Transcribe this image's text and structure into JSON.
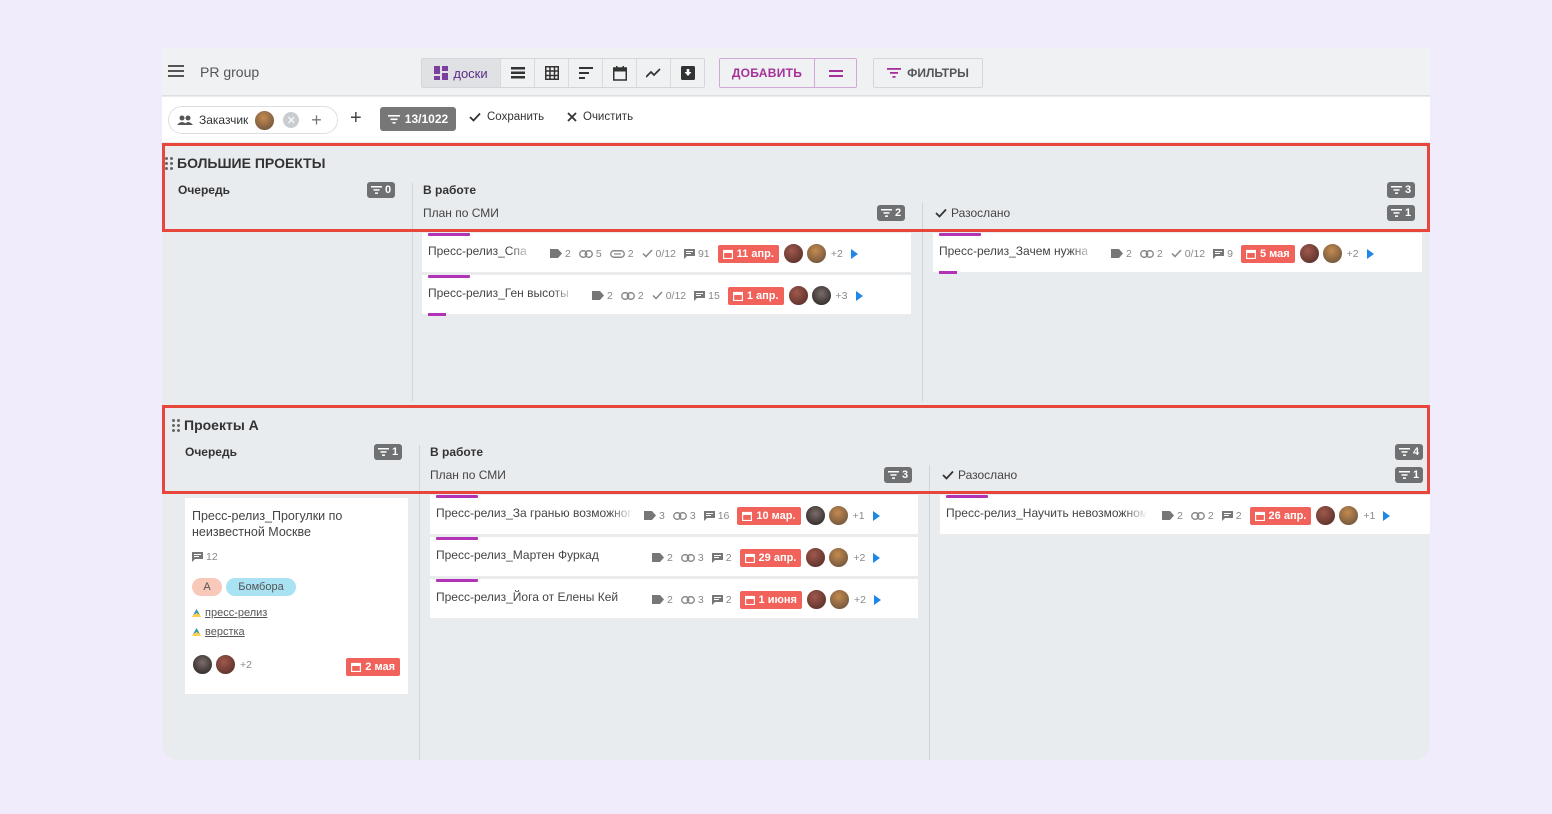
{
  "app": {
    "title": "PR group"
  },
  "toolbar": {
    "views": [
      {
        "label": "доски",
        "icon": "board-icon"
      },
      {
        "icon": "list-icon"
      },
      {
        "icon": "table-icon"
      },
      {
        "icon": "gantt-icon"
      },
      {
        "icon": "calendar-icon"
      },
      {
        "icon": "chart-icon"
      },
      {
        "icon": "archive-icon"
      }
    ],
    "add_label": "ДОБАВИТЬ",
    "filters_label": "ФИЛЬТРЫ"
  },
  "filterbar": {
    "chip_label": "Заказчик",
    "count": "13/1022",
    "save_label": "Сохранить",
    "clear_label": "Очистить"
  },
  "lanes": [
    {
      "title": "БОЛЬШИЕ ПРОЕКТЫ",
      "queue": {
        "label": "Очередь",
        "count": "0"
      },
      "in_work": {
        "label": "В работе",
        "count": "3"
      },
      "plan": {
        "label": "План по СМИ",
        "count": "2"
      },
      "sent": {
        "label": "Разослано",
        "count": "1"
      },
      "plan_cards": [
        {
          "title": "Пресс-релиз_Спа",
          "tags": "2",
          "links": "5",
          "files": "2",
          "checks": "0/12",
          "comments": "91",
          "date": "11 апр.",
          "more": "+2"
        },
        {
          "title": "Пресс-релиз_Ген высоты",
          "tags": "2",
          "links": "2",
          "checks": "0/12",
          "comments": "15",
          "date": "1 апр.",
          "more": "+3"
        }
      ],
      "sent_cards": [
        {
          "title": "Пресс-релиз_Зачем нужна",
          "tags": "2",
          "links": "2",
          "checks": "0/12",
          "comments": "9",
          "date": "5 мая",
          "more": "+2"
        }
      ]
    },
    {
      "title": "Проекты А",
      "queue": {
        "label": "Очередь",
        "count": "1"
      },
      "in_work": {
        "label": "В работе",
        "count": "4"
      },
      "plan": {
        "label": "План по СМИ",
        "count": "3"
      },
      "sent": {
        "label": "Разослано",
        "count": "1"
      },
      "queue_card": {
        "title": "Пресс-релиз_Прогулки по неизвестной Москве",
        "comments": "12",
        "tag_a": "А",
        "tag_b": "Бомбора",
        "link1": "пресс-релиз",
        "link2": "верстка",
        "more": "+2",
        "date": "2 мая"
      },
      "plan_cards": [
        {
          "title": "Пресс-релиз_За гранью возможного",
          "tags": "3",
          "links": "3",
          "comments": "16",
          "date": "10 мар.",
          "more": "+1"
        },
        {
          "title": "Пресс-релиз_Мартен Фуркад",
          "tags": "2",
          "links": "3",
          "comments": "2",
          "date": "29 апр.",
          "more": "+2"
        },
        {
          "title": "Пресс-релиз_Йога от Елены Кей",
          "tags": "2",
          "links": "3",
          "comments": "2",
          "date": "1 июня",
          "more": "+2"
        }
      ],
      "sent_cards": [
        {
          "title": "Пресс-релиз_Научить невозможному",
          "tags": "2",
          "links": "2",
          "comments": "2",
          "date": "26 апр.",
          "more": "+1"
        }
      ]
    }
  ],
  "colors": {
    "accent": "#a6309a",
    "date": "#f0625a",
    "highlight": "#e8453c",
    "play": "#1e88e5"
  }
}
